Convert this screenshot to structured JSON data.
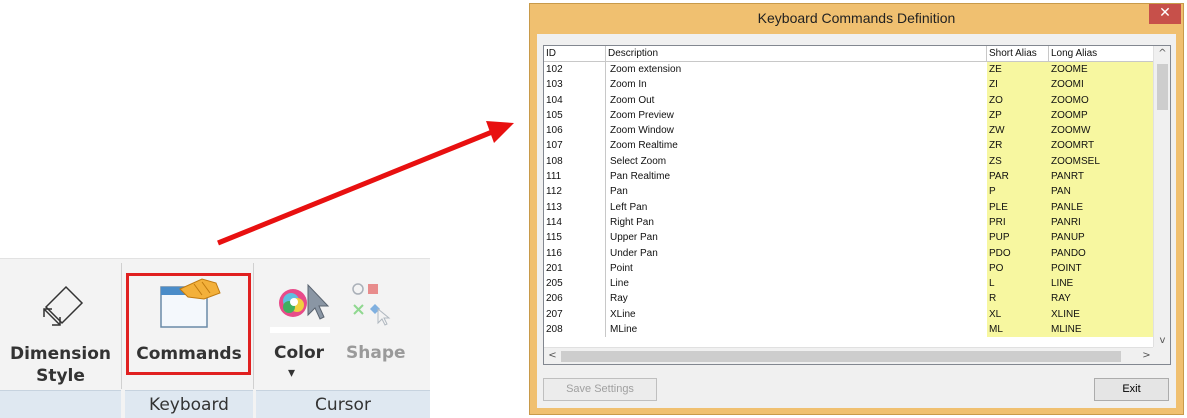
{
  "ribbon": {
    "dimension_label_line1": "Dimension",
    "dimension_label_line2": "Style",
    "commands_label": "Commands",
    "color_label": "Color",
    "color_dropdown": "▾",
    "shape_label": "Shape",
    "group_keyboard": "Keyboard",
    "group_cursor": "Cursor"
  },
  "dialog": {
    "title": "Keyboard Commands Definition",
    "close": "✕",
    "columns": [
      "ID",
      "Description",
      "Short Alias",
      "Long Alias"
    ],
    "rows": [
      {
        "id": "102",
        "desc": "Zoom extension",
        "short": "ZE",
        "long": "ZOOME"
      },
      {
        "id": "103",
        "desc": "Zoom In",
        "short": "ZI",
        "long": "ZOOMI"
      },
      {
        "id": "104",
        "desc": "Zoom Out",
        "short": "ZO",
        "long": "ZOOMO"
      },
      {
        "id": "105",
        "desc": "Zoom Preview",
        "short": "ZP",
        "long": "ZOOMP"
      },
      {
        "id": "106",
        "desc": "Zoom Window",
        "short": "ZW",
        "long": "ZOOMW"
      },
      {
        "id": "107",
        "desc": "Zoom Realtime",
        "short": "ZR",
        "long": "ZOOMRT"
      },
      {
        "id": "108",
        "desc": "Select Zoom",
        "short": "ZS",
        "long": "ZOOMSEL"
      },
      {
        "id": "111",
        "desc": "Pan Realtime",
        "short": "PAR",
        "long": "PANRT"
      },
      {
        "id": "112",
        "desc": "Pan",
        "short": "P",
        "long": "PAN"
      },
      {
        "id": "113",
        "desc": "Left Pan",
        "short": "PLE",
        "long": "PANLE"
      },
      {
        "id": "114",
        "desc": "Right Pan",
        "short": "PRI",
        "long": "PANRI"
      },
      {
        "id": "115",
        "desc": "Upper Pan",
        "short": "PUP",
        "long": "PANUP"
      },
      {
        "id": "116",
        "desc": "Under Pan",
        "short": "PDO",
        "long": "PANDO"
      },
      {
        "id": "201",
        "desc": "Point",
        "short": "PO",
        "long": "POINT"
      },
      {
        "id": "205",
        "desc": "Line",
        "short": "L",
        "long": "LINE"
      },
      {
        "id": "206",
        "desc": "Ray",
        "short": "R",
        "long": "RAY"
      },
      {
        "id": "207",
        "desc": "XLine",
        "short": "XL",
        "long": "XLINE"
      },
      {
        "id": "208",
        "desc": "MLine",
        "short": "ML",
        "long": "MLINE"
      }
    ],
    "scroll_up": "^",
    "scroll_down": "v",
    "scroll_left": "<",
    "scroll_right": ">",
    "save_button": "Save Settings",
    "exit_button": "Exit"
  },
  "colors": {
    "highlight": "#e02020",
    "arrow": "#e81010",
    "alias_bg": "#f7f7a0",
    "dialog_frame": "#f0c070",
    "close_bg": "#c7504a"
  }
}
